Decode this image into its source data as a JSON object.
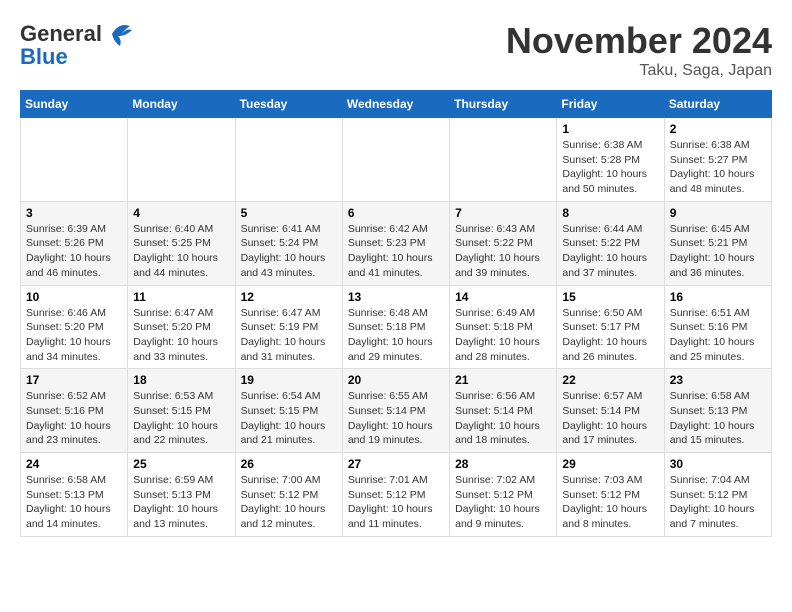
{
  "header": {
    "logo_general": "General",
    "logo_blue": "Blue",
    "month_title": "November 2024",
    "location": "Taku, Saga, Japan"
  },
  "weekdays": [
    "Sunday",
    "Monday",
    "Tuesday",
    "Wednesday",
    "Thursday",
    "Friday",
    "Saturday"
  ],
  "weeks": [
    [
      {
        "day": "",
        "info": ""
      },
      {
        "day": "",
        "info": ""
      },
      {
        "day": "",
        "info": ""
      },
      {
        "day": "",
        "info": ""
      },
      {
        "day": "",
        "info": ""
      },
      {
        "day": "1",
        "info": "Sunrise: 6:38 AM\nSunset: 5:28 PM\nDaylight: 10 hours\nand 50 minutes."
      },
      {
        "day": "2",
        "info": "Sunrise: 6:38 AM\nSunset: 5:27 PM\nDaylight: 10 hours\nand 48 minutes."
      }
    ],
    [
      {
        "day": "3",
        "info": "Sunrise: 6:39 AM\nSunset: 5:26 PM\nDaylight: 10 hours\nand 46 minutes."
      },
      {
        "day": "4",
        "info": "Sunrise: 6:40 AM\nSunset: 5:25 PM\nDaylight: 10 hours\nand 44 minutes."
      },
      {
        "day": "5",
        "info": "Sunrise: 6:41 AM\nSunset: 5:24 PM\nDaylight: 10 hours\nand 43 minutes."
      },
      {
        "day": "6",
        "info": "Sunrise: 6:42 AM\nSunset: 5:23 PM\nDaylight: 10 hours\nand 41 minutes."
      },
      {
        "day": "7",
        "info": "Sunrise: 6:43 AM\nSunset: 5:22 PM\nDaylight: 10 hours\nand 39 minutes."
      },
      {
        "day": "8",
        "info": "Sunrise: 6:44 AM\nSunset: 5:22 PM\nDaylight: 10 hours\nand 37 minutes."
      },
      {
        "day": "9",
        "info": "Sunrise: 6:45 AM\nSunset: 5:21 PM\nDaylight: 10 hours\nand 36 minutes."
      }
    ],
    [
      {
        "day": "10",
        "info": "Sunrise: 6:46 AM\nSunset: 5:20 PM\nDaylight: 10 hours\nand 34 minutes."
      },
      {
        "day": "11",
        "info": "Sunrise: 6:47 AM\nSunset: 5:20 PM\nDaylight: 10 hours\nand 33 minutes."
      },
      {
        "day": "12",
        "info": "Sunrise: 6:47 AM\nSunset: 5:19 PM\nDaylight: 10 hours\nand 31 minutes."
      },
      {
        "day": "13",
        "info": "Sunrise: 6:48 AM\nSunset: 5:18 PM\nDaylight: 10 hours\nand 29 minutes."
      },
      {
        "day": "14",
        "info": "Sunrise: 6:49 AM\nSunset: 5:18 PM\nDaylight: 10 hours\nand 28 minutes."
      },
      {
        "day": "15",
        "info": "Sunrise: 6:50 AM\nSunset: 5:17 PM\nDaylight: 10 hours\nand 26 minutes."
      },
      {
        "day": "16",
        "info": "Sunrise: 6:51 AM\nSunset: 5:16 PM\nDaylight: 10 hours\nand 25 minutes."
      }
    ],
    [
      {
        "day": "17",
        "info": "Sunrise: 6:52 AM\nSunset: 5:16 PM\nDaylight: 10 hours\nand 23 minutes."
      },
      {
        "day": "18",
        "info": "Sunrise: 6:53 AM\nSunset: 5:15 PM\nDaylight: 10 hours\nand 22 minutes."
      },
      {
        "day": "19",
        "info": "Sunrise: 6:54 AM\nSunset: 5:15 PM\nDaylight: 10 hours\nand 21 minutes."
      },
      {
        "day": "20",
        "info": "Sunrise: 6:55 AM\nSunset: 5:14 PM\nDaylight: 10 hours\nand 19 minutes."
      },
      {
        "day": "21",
        "info": "Sunrise: 6:56 AM\nSunset: 5:14 PM\nDaylight: 10 hours\nand 18 minutes."
      },
      {
        "day": "22",
        "info": "Sunrise: 6:57 AM\nSunset: 5:14 PM\nDaylight: 10 hours\nand 17 minutes."
      },
      {
        "day": "23",
        "info": "Sunrise: 6:58 AM\nSunset: 5:13 PM\nDaylight: 10 hours\nand 15 minutes."
      }
    ],
    [
      {
        "day": "24",
        "info": "Sunrise: 6:58 AM\nSunset: 5:13 PM\nDaylight: 10 hours\nand 14 minutes."
      },
      {
        "day": "25",
        "info": "Sunrise: 6:59 AM\nSunset: 5:13 PM\nDaylight: 10 hours\nand 13 minutes."
      },
      {
        "day": "26",
        "info": "Sunrise: 7:00 AM\nSunset: 5:12 PM\nDaylight: 10 hours\nand 12 minutes."
      },
      {
        "day": "27",
        "info": "Sunrise: 7:01 AM\nSunset: 5:12 PM\nDaylight: 10 hours\nand 11 minutes."
      },
      {
        "day": "28",
        "info": "Sunrise: 7:02 AM\nSunset: 5:12 PM\nDaylight: 10 hours\nand 9 minutes."
      },
      {
        "day": "29",
        "info": "Sunrise: 7:03 AM\nSunset: 5:12 PM\nDaylight: 10 hours\nand 8 minutes."
      },
      {
        "day": "30",
        "info": "Sunrise: 7:04 AM\nSunset: 5:12 PM\nDaylight: 10 hours\nand 7 minutes."
      }
    ]
  ]
}
